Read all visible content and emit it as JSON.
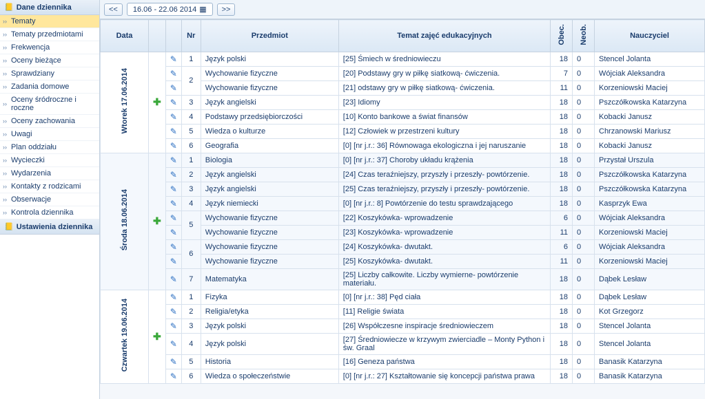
{
  "sidebar": {
    "sections": [
      {
        "title": "Dane dziennika",
        "items": [
          "Tematy",
          "Tematy przedmiotami",
          "Frekwencja",
          "Oceny bieżące",
          "Sprawdziany",
          "Zadania domowe",
          "Oceny śródroczne i roczne",
          "Oceny zachowania",
          "Uwagi",
          "Plan oddziału",
          "Wycieczki",
          "Wydarzenia",
          "Kontakty z rodzicami",
          "Obserwacje",
          "Kontrola dziennika"
        ],
        "activeIndex": 0
      },
      {
        "title": "Ustawienia dziennika",
        "items": []
      }
    ]
  },
  "toolbar": {
    "prev": "<<",
    "next": ">>",
    "date_range": "16.06 - 22.06 2014"
  },
  "columns": {
    "data": "Data",
    "nr": "Nr",
    "subject": "Przedmiot",
    "topic": "Temat zajęć edukacyjnych",
    "obec": "Obec.",
    "neob": "Neob.",
    "teacher": "Nauczyciel"
  },
  "days": [
    {
      "label": "Wtorek 17.06.2014",
      "alt": false,
      "rows": [
        {
          "nr": "1",
          "subject": "Język polski",
          "topic": "[25] Śmiech w średniowieczu",
          "obec": "18",
          "neob": "0",
          "teacher": "Stencel Jolanta"
        },
        {
          "subject": "Wychowanie fizyczne",
          "topic": "[20] Podstawy gry w piłkę siatkową- ćwiczenia.",
          "obec": "7",
          "neob": "0",
          "teacher": "Wójciak Aleksandra",
          "nr_start": "2",
          "nr_span": 2
        },
        {
          "subject": "Wychowanie fizyczne",
          "topic": "[21] odstawy gry w piłkę siatkową- ćwiczenia.",
          "obec": "11",
          "neob": "0",
          "teacher": "Korzeniowski Maciej"
        },
        {
          "nr": "3",
          "subject": "Język angielski",
          "topic": "[23] Idiomy",
          "obec": "18",
          "neob": "0",
          "teacher": "Pszczółkowska Katarzyna"
        },
        {
          "nr": "4",
          "subject": "Podstawy przedsiębiorczości",
          "topic": "[10] Konto bankowe a świat finansów",
          "obec": "18",
          "neob": "0",
          "teacher": "Kobacki Janusz"
        },
        {
          "nr": "5",
          "subject": "Wiedza o kulturze",
          "topic": "[12] Człowiek w przestrzeni kultury",
          "obec": "18",
          "neob": "0",
          "teacher": "Chrzanowski Mariusz"
        },
        {
          "nr": "6",
          "subject": "Geografia",
          "topic": "[0] [nr j.r.: 36] Równowaga ekologiczna i jej naruszanie",
          "obec": "18",
          "neob": "0",
          "teacher": "Kobacki Janusz"
        }
      ]
    },
    {
      "label": "Środa 18.06.2014",
      "alt": true,
      "rows": [
        {
          "nr": "1",
          "subject": "Biologia",
          "topic": "[0] [nr j.r.: 37] Choroby układu krążenia",
          "obec": "18",
          "neob": "0",
          "teacher": "Przystał Urszula"
        },
        {
          "nr": "2",
          "subject": "Język angielski",
          "topic": "[24] Czas teraźniejszy, przyszły i przeszły- powtórzenie.",
          "obec": "18",
          "neob": "0",
          "teacher": "Pszczółkowska Katarzyna"
        },
        {
          "nr": "3",
          "subject": "Język angielski",
          "topic": "[25] Czas teraźniejszy, przyszły i przeszły- powtórzenie.",
          "obec": "18",
          "neob": "0",
          "teacher": "Pszczółkowska Katarzyna"
        },
        {
          "nr": "4",
          "subject": "Język niemiecki",
          "topic": "[0] [nr j.r.: 8] Powtórzenie do testu sprawdzającego",
          "obec": "18",
          "neob": "0",
          "teacher": "Kasprzyk Ewa"
        },
        {
          "subject": "Wychowanie fizyczne",
          "topic": "[22] Koszykówka- wprowadzenie",
          "obec": "6",
          "neob": "0",
          "teacher": "Wójciak Aleksandra",
          "nr_start": "5",
          "nr_span": 2
        },
        {
          "subject": "Wychowanie fizyczne",
          "topic": "[23] Koszykówka- wprowadzenie",
          "obec": "11",
          "neob": "0",
          "teacher": "Korzeniowski Maciej"
        },
        {
          "subject": "Wychowanie fizyczne",
          "topic": "[24] Koszykówka- dwutakt.",
          "obec": "6",
          "neob": "0",
          "teacher": "Wójciak Aleksandra",
          "nr_start": "6",
          "nr_span": 2
        },
        {
          "subject": "Wychowanie fizyczne",
          "topic": "[25] Koszykówka- dwutakt.",
          "obec": "11",
          "neob": "0",
          "teacher": "Korzeniowski Maciej"
        },
        {
          "nr": "7",
          "subject": "Matematyka",
          "topic": "[25] Liczby całkowite. Liczby wymierne- powtórzenie materiału.",
          "obec": "18",
          "neob": "0",
          "teacher": "Dąbek Lesław"
        }
      ]
    },
    {
      "label": "Czwartek 19.06.2014",
      "alt": false,
      "rows": [
        {
          "nr": "1",
          "subject": "Fizyka",
          "topic": "[0] [nr j.r.: 38] Pęd ciała",
          "obec": "18",
          "neob": "0",
          "teacher": "Dąbek Lesław"
        },
        {
          "nr": "2",
          "subject": "Religia/etyka",
          "topic": "[11] Religie świata",
          "obec": "18",
          "neob": "0",
          "teacher": "Kot Grzegorz"
        },
        {
          "nr": "3",
          "subject": "Język polski",
          "topic": "[26] Współczesne inspiracje średniowieczem",
          "obec": "18",
          "neob": "0",
          "teacher": "Stencel Jolanta"
        },
        {
          "nr": "4",
          "subject": "Język polski",
          "topic": "[27] Średniowiecze w krzywym zwierciadle – Monty Python i św. Graal",
          "obec": "18",
          "neob": "0",
          "teacher": "Stencel Jolanta"
        },
        {
          "nr": "5",
          "subject": "Historia",
          "topic": "[16] Geneza państwa",
          "obec": "18",
          "neob": "0",
          "teacher": "Banasik Katarzyna"
        },
        {
          "nr": "6",
          "subject": "Wiedza o społeczeństwie",
          "topic": "[0] [nr j.r.: 27] Kształtowanie się koncepcji państwa prawa",
          "obec": "18",
          "neob": "0",
          "teacher": "Banasik Katarzyna"
        }
      ]
    }
  ]
}
